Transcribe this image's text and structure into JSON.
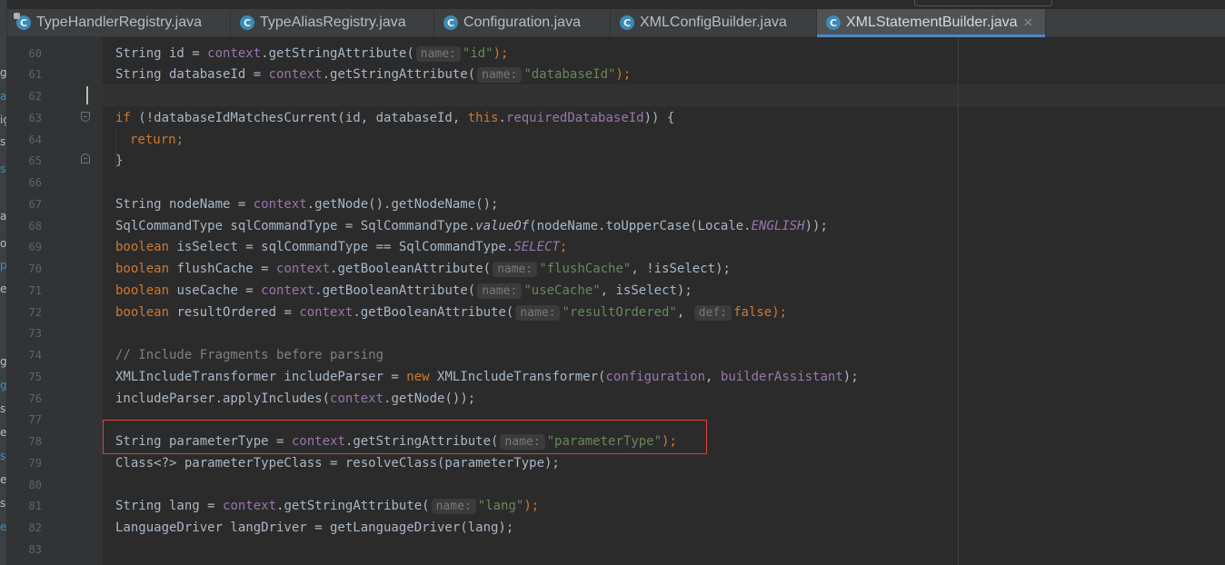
{
  "tabs": [
    {
      "label": "TypeHandlerRegistry.java",
      "pinned": true,
      "active": false
    },
    {
      "label": "TypeAliasRegistry.java",
      "pinned": false,
      "active": false
    },
    {
      "label": "Configuration.java",
      "pinned": false,
      "active": false
    },
    {
      "label": "XMLConfigBuilder.java",
      "pinned": false,
      "active": false
    },
    {
      "label": "XMLStatementBuilder.java",
      "pinned": false,
      "active": true
    }
  ],
  "tab_icon_glyph": "C",
  "close_glyph": "×",
  "left_panel_fragments": [
    "g",
    "at",
    "ig",
    "s",
    "s",
    "a",
    "oj",
    "p",
    "es",
    "g",
    "g",
    "s",
    "es",
    "s",
    "es",
    "s",
    "es"
  ],
  "lines": [
    {
      "n": "60"
    },
    {
      "n": "61"
    },
    {
      "n": "62"
    },
    {
      "n": "63"
    },
    {
      "n": "64"
    },
    {
      "n": "65"
    },
    {
      "n": "66"
    },
    {
      "n": "67"
    },
    {
      "n": "68"
    },
    {
      "n": "69"
    },
    {
      "n": "70"
    },
    {
      "n": "71"
    },
    {
      "n": "72"
    },
    {
      "n": "73"
    },
    {
      "n": "74"
    },
    {
      "n": "75"
    },
    {
      "n": "76"
    },
    {
      "n": "77"
    },
    {
      "n": "78"
    },
    {
      "n": "79"
    },
    {
      "n": "80"
    },
    {
      "n": "81"
    },
    {
      "n": "82"
    },
    {
      "n": "83"
    }
  ],
  "code": {
    "l60": {
      "a": "String id = ",
      "b": "context",
      ".c": "",
      "c": ".getStringAttribute(",
      "hint": "name:",
      "s": "\"id\"",
      "e": ");"
    },
    "l61": {
      "a": "String databaseId = ",
      "b": "context",
      "c": ".getStringAttribute(",
      "hint": "name:",
      "s": "\"databaseId\"",
      "e": ");"
    },
    "l63": {
      "a": "if",
      "b": " (!databaseIdMatchesCurrent(id, databaseId, ",
      "c": "this",
      "d": ".",
      "e": "requiredDatabaseId",
      "f": ")) {"
    },
    "l64": {
      "a": "return",
      "b": ";"
    },
    "l65": {
      "a": "}"
    },
    "l67": {
      "a": "String nodeName = ",
      "b": "context",
      "c": ".getNode().getNodeName();"
    },
    "l68": {
      "a": "SqlCommandType sqlCommandType = SqlCommandType.",
      "b": "valueOf",
      "c": "(nodeName.toUpperCase(Locale.",
      "d": "ENGLISH",
      "e": "));"
    },
    "l69": {
      "a": "boolean",
      "b": " isSelect = sqlCommandType == SqlCommandType.",
      "c": "SELECT",
      "d": ";"
    },
    "l70": {
      "a": "boolean",
      "b": " flushCache = ",
      "c": "context",
      "d": ".getBooleanAttribute(",
      "hint": "name:",
      "s": "\"flushCache\"",
      "e": ", !isSelect);"
    },
    "l71": {
      "a": "boolean",
      "b": " useCache = ",
      "c": "context",
      "d": ".getBooleanAttribute(",
      "hint": "name:",
      "s": "\"useCache\"",
      "e": ", isSelect);"
    },
    "l72": {
      "a": "boolean",
      "b": " resultOrdered = ",
      "c": "context",
      "d": ".getBooleanAttribute(",
      "hint": "name:",
      "s": "\"resultOrdered\"",
      "e": ", ",
      "hint2": "def:",
      "f": "false",
      "g": ");"
    },
    "l74": {
      "a": "// Include Fragments before parsing"
    },
    "l75": {
      "a": "XMLIncludeTransformer includeParser = ",
      "b": "new",
      "c": " XMLIncludeTransformer(",
      "d": "configuration",
      ".e": "",
      "e": ", ",
      "f": "builderAssistant",
      "g": ");"
    },
    "l76": {
      "a": "includeParser.applyIncludes(",
      "b": "context",
      "c": ".getNode());"
    },
    "l78": {
      "a": "String parameterType = ",
      "b": "context",
      "c": ".getStringAttribute(",
      "hint": "name:",
      "s": "\"parameterType\"",
      "e": ");"
    },
    "l79": {
      "a": "Class<?> parameterTypeClass = resolveClass(parameterType);"
    },
    "l81": {
      "a": "String lang = ",
      "b": "context",
      "c": ".getStringAttribute(",
      "hint": "name:",
      "s": "\"lang\"",
      "e": ");"
    },
    "l82": {
      "a": "LanguageDriver langDriver = getLanguageDriver(lang);"
    }
  },
  "colors": {
    "keyword": "#cc7832",
    "field": "#9876aa",
    "string": "#6a8759",
    "comment": "#808080",
    "highlight": "#e0403a",
    "accent": "#4a88c7"
  }
}
